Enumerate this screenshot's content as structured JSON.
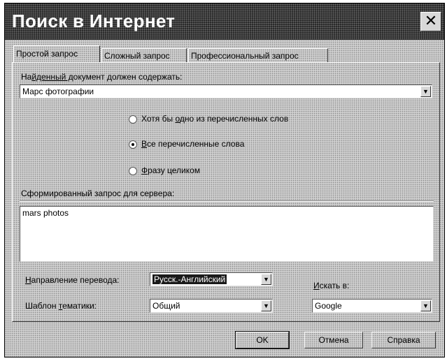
{
  "window": {
    "title": "Поиск в Интернет",
    "close_label": "✕"
  },
  "tabs": [
    {
      "label": "Простой запрос",
      "active": true
    },
    {
      "label": "Сложный запрос",
      "active": false
    },
    {
      "label": "Профессиональный запрос",
      "active": false
    }
  ],
  "document_contains": {
    "label_pre": "На",
    "label_u": "йденный д",
    "label_post": "окумент должен содержать:",
    "value": "Марс фотографии"
  },
  "match_options": [
    {
      "pre": "Хотя бы ",
      "u": "о",
      "post": "дно из перечисленных слов",
      "selected": false
    },
    {
      "pre": "",
      "u": "В",
      "post": "се перечисленные слова",
      "selected": true
    },
    {
      "pre": "",
      "u": "Ф",
      "post": "разу целиком",
      "selected": false
    }
  ],
  "server_query": {
    "label": "Сформированный запрос для сервера:",
    "value": "mars photos"
  },
  "translation": {
    "label_u": "Н",
    "label_post": "аправление перевода:",
    "value": "Русск.-Английский"
  },
  "topic_template": {
    "label_pre": "Шаблон ",
    "label_u": "т",
    "label_post": "ематики:",
    "value": "Общий"
  },
  "search_in": {
    "label_u": "И",
    "label_post": "скать в:",
    "value": "Google"
  },
  "buttons": {
    "ok": "OK",
    "cancel": "Отмена",
    "help": "Справка"
  },
  "dropdown_glyph": "▼"
}
